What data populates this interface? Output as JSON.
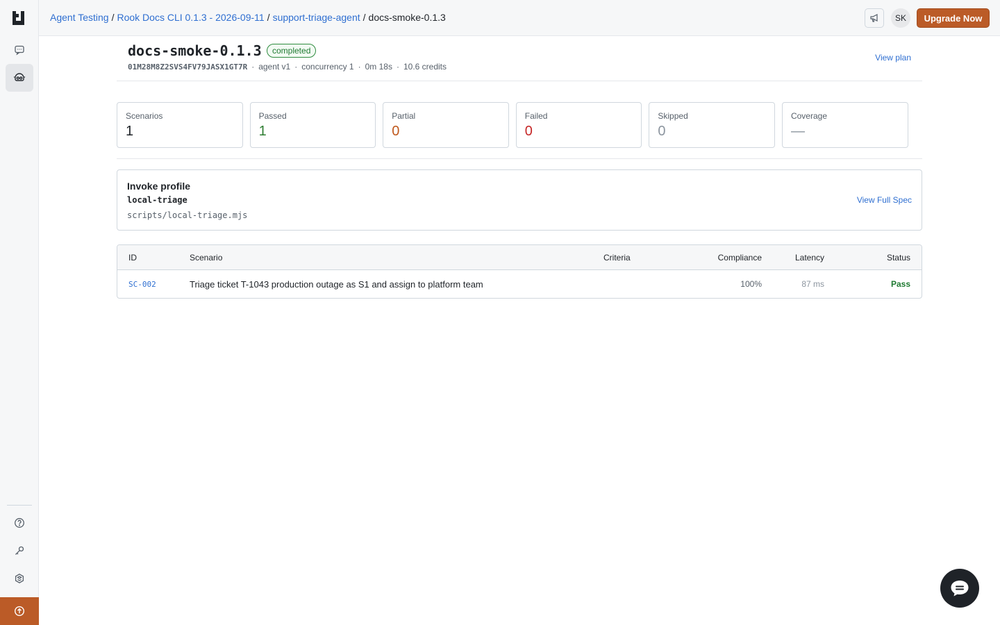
{
  "app": {
    "name": "Agent Testing"
  },
  "breadcrumb": {
    "items": [
      "Agent Testing",
      "Rook Docs CLI 0.1.3 - 2026-09-11",
      "support-triage-agent"
    ],
    "current": "docs-smoke-0.1.3",
    "separator": "/"
  },
  "header": {
    "avatar_initials": "SK",
    "upgrade_label": "Upgrade Now",
    "announce_icon": "megaphone-icon"
  },
  "sidebar": {
    "items": [
      {
        "icon": "chat-icon",
        "active": false
      },
      {
        "icon": "agent-testing-icon",
        "active": true
      }
    ],
    "bottom_items": [
      {
        "icon": "help-icon"
      },
      {
        "icon": "key-icon"
      },
      {
        "icon": "settings-icon"
      }
    ],
    "upgrade_icon": "arrow-up-circle-icon"
  },
  "run": {
    "title": "docs-smoke-0.1.3",
    "status": "completed",
    "id": "01M28M8Z2SVS4FV79JASX1GT7R",
    "agent": "agent v1",
    "concurrency": "concurrency 1",
    "duration": "0m 18s",
    "credits": "10.6 credits",
    "meta_separator": "·",
    "view_plan": "View plan"
  },
  "stats": [
    {
      "label": "Scenarios",
      "value": "1",
      "color": "#1f2328"
    },
    {
      "label": "Passed",
      "value": "1",
      "color": "#2e7d32"
    },
    {
      "label": "Partial",
      "value": "0",
      "color": "#c0591d"
    },
    {
      "label": "Failed",
      "value": "0",
      "color": "#c62828"
    },
    {
      "label": "Skipped",
      "value": "0",
      "color": "#8c959f"
    },
    {
      "label": "Coverage",
      "value": "—",
      "color": "#8c959f"
    }
  ],
  "invoke": {
    "title": "Invoke profile",
    "name": "local-triage",
    "path": "scripts/local-triage.mjs",
    "view_spec": "View Full Spec"
  },
  "table": {
    "columns": [
      "ID",
      "Scenario",
      "Criteria",
      "Compliance",
      "Latency",
      "Status"
    ],
    "rows": [
      {
        "id": "SC-002",
        "scenario": "Triage ticket T-1043 production outage as S1 and assign to platform team",
        "criteria": "",
        "compliance": "100%",
        "latency": "87 ms",
        "status": "Pass"
      }
    ]
  },
  "colors": {
    "accent": "#2f6fd1",
    "brand": "#bb5b27",
    "success": "#1f7a32"
  },
  "chat_fab_icon": "chat-bubble-icon"
}
